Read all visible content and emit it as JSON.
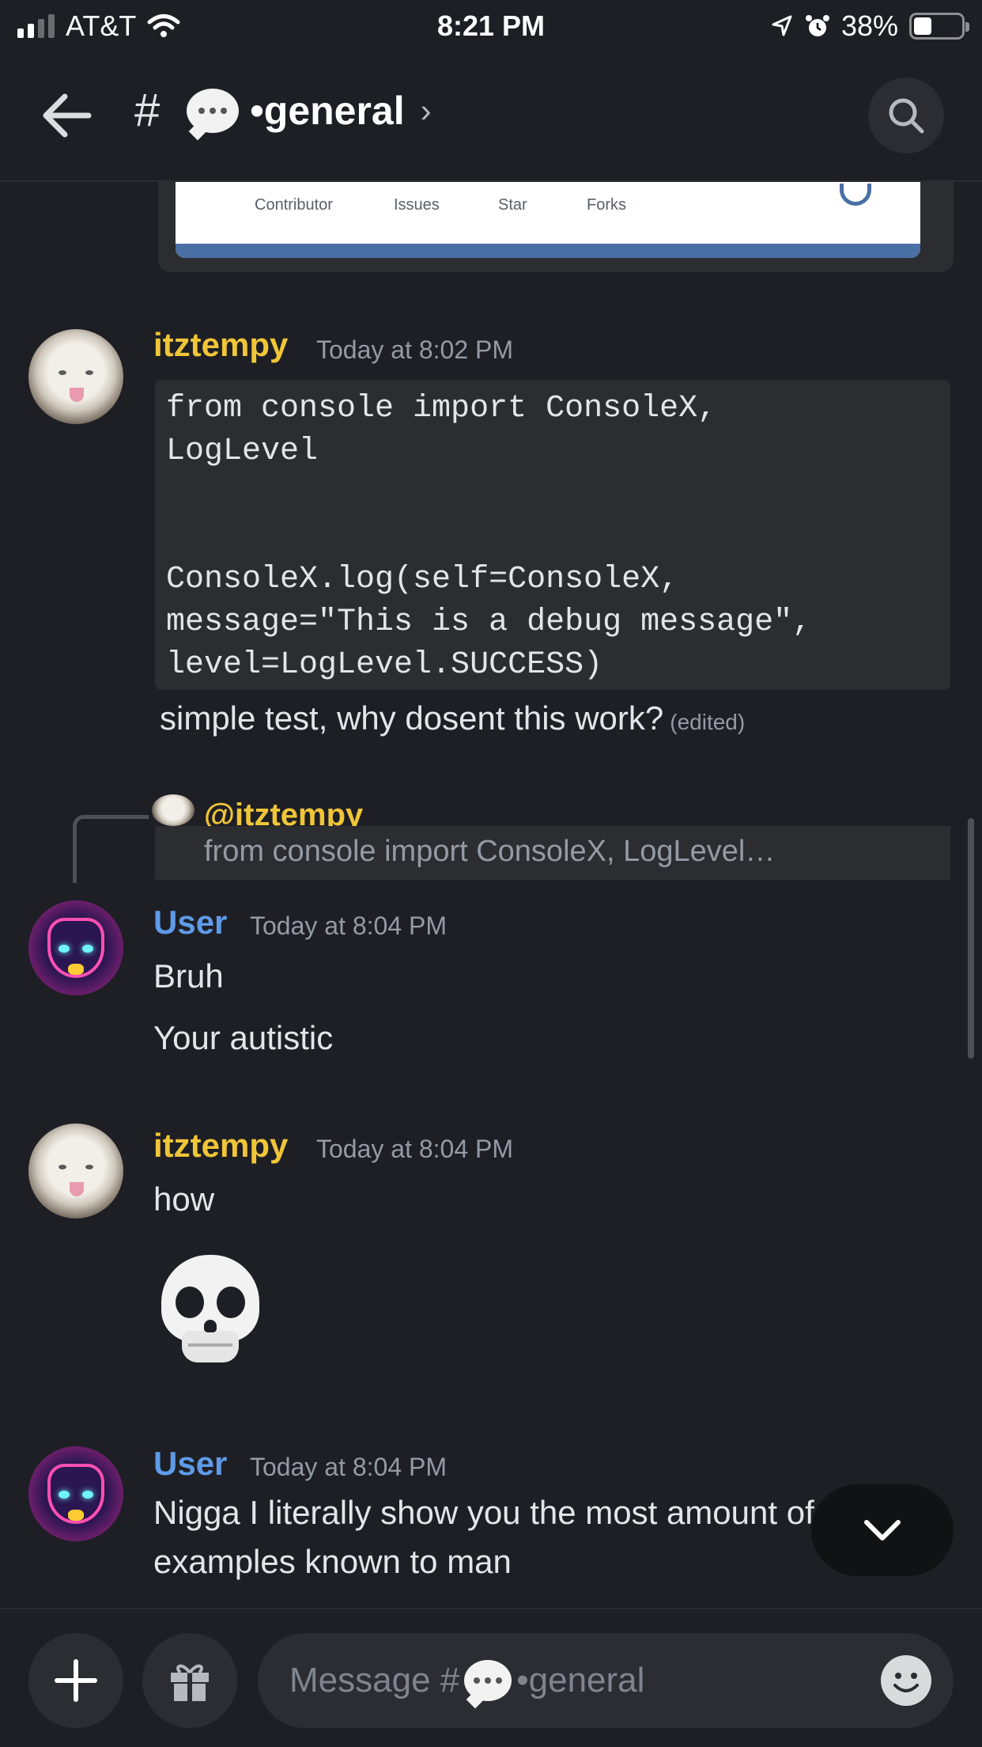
{
  "status_bar": {
    "carrier": "AT&T",
    "time": "8:21 PM",
    "battery_percent": "38%",
    "battery_level": 0.38
  },
  "header": {
    "hash": "#",
    "channel_name": "•general",
    "chevron": "›",
    "icons": [
      "back-arrow-icon",
      "speech-bubble-emoji",
      "search-icon"
    ]
  },
  "embed": {
    "stats": [
      {
        "label": "Contributor"
      },
      {
        "label": "Issues"
      },
      {
        "label": "Star"
      },
      {
        "label": "Forks"
      }
    ],
    "accent_color": "#4a6fa5"
  },
  "messages": [
    {
      "author": "itztempy",
      "author_color": "#f0c537",
      "timestamp": "Today at 8:02 PM",
      "code_lines": [
        "from console import ConsoleX,",
        "LogLevel",
        "",
        "",
        "ConsoleX.log(self=ConsoleX,",
        "message=\"This is a debug message\",",
        "level=LogLevel.SUCCESS)"
      ],
      "text": "simple test, why dosent this work?",
      "edited": "(edited)"
    },
    {
      "reply_to": "@itztempy",
      "reply_preview": "from console import ConsoleX, LogLevel…",
      "author": "User",
      "author_color": "#5e9be8",
      "timestamp": "Today at 8:04 PM",
      "lines": [
        "Bruh",
        "Your autistic"
      ]
    },
    {
      "author": "itztempy",
      "timestamp": "Today at 8:04 PM",
      "lines": [
        "how"
      ],
      "emoji": "skull"
    },
    {
      "author": "User",
      "timestamp": "Today at 8:04 PM",
      "lines": [
        "Nigga I literally show you the most amount of",
        "examples known to man"
      ]
    }
  ],
  "composer": {
    "placeholder_prefix": "Message #",
    "placeholder_suffix": "•general",
    "icons": [
      "plus-icon",
      "gift-icon",
      "emoji-icon"
    ]
  }
}
